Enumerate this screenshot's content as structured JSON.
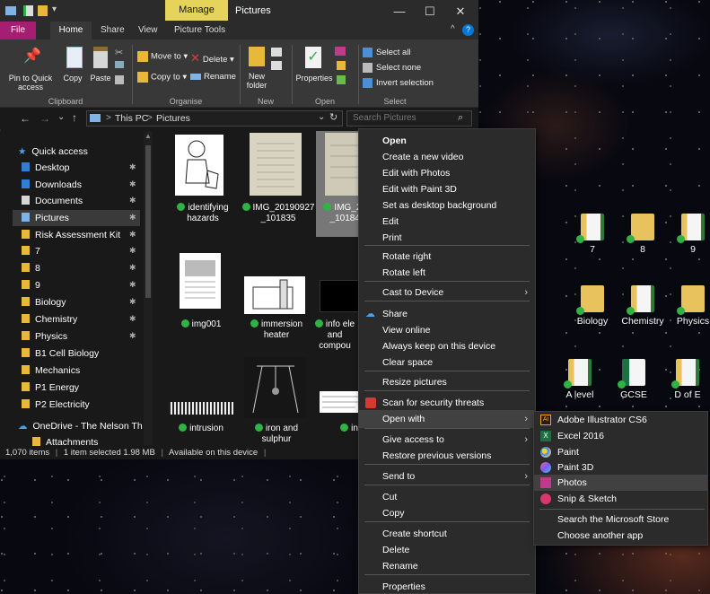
{
  "titlebar": {
    "manage_tab": "Manage",
    "title": "Pictures",
    "minimize": "—",
    "maximize": "☐",
    "close": "✕"
  },
  "tabs": {
    "file": "File",
    "home": "Home",
    "share": "Share",
    "view": "View",
    "picture_tools": "Picture Tools"
  },
  "ribbon": {
    "pin": "Pin to Quick access",
    "copy": "Copy",
    "paste": "Paste",
    "move_to": "Move to",
    "copy_to": "Copy to",
    "delete": "Delete",
    "rename": "Rename",
    "new_folder": "New folder",
    "properties": "Properties",
    "select_all": "Select all",
    "select_none": "Select none",
    "invert_selection": "Invert selection",
    "groups": {
      "clipboard": "Clipboard",
      "organise": "Organise",
      "new": "New",
      "open": "Open",
      "select": "Select"
    }
  },
  "address": {
    "path_this_pc": "This PC",
    "path_pictures": "Pictures",
    "search_placeholder": "Search Pictures",
    "sep": ">"
  },
  "nav": {
    "quick_access": "Quick access",
    "items": [
      {
        "label": "Desktop",
        "pinned": true
      },
      {
        "label": "Downloads",
        "pinned": true
      },
      {
        "label": "Documents",
        "pinned": true
      },
      {
        "label": "Pictures",
        "pinned": true
      },
      {
        "label": "Risk Assessment Kit",
        "pinned": true
      },
      {
        "label": "7",
        "pinned": true
      },
      {
        "label": "8",
        "pinned": true
      },
      {
        "label": "9",
        "pinned": true
      },
      {
        "label": "Biology",
        "pinned": true
      },
      {
        "label": "Chemistry",
        "pinned": true
      },
      {
        "label": "Physics",
        "pinned": true
      },
      {
        "label": "B1 Cell Biology",
        "pinned": false
      },
      {
        "label": "Mechanics",
        "pinned": false
      },
      {
        "label": "P1 Energy",
        "pinned": false
      },
      {
        "label": "P2 Electricity",
        "pinned": false
      }
    ],
    "onedrive": "OneDrive - The Nelson Th",
    "attachments": "Attachments"
  },
  "files": [
    {
      "line1": "identifying",
      "line2": "hazards"
    },
    {
      "line1": "IMG_20190927",
      "line2": "_101835"
    },
    {
      "line1": "IMG_201",
      "line2": "_101842"
    },
    {
      "line1": "img001",
      "line2": ""
    },
    {
      "line1": "immersion",
      "line2": "heater"
    },
    {
      "line1": "info ele",
      "line2": "and",
      "line3": "compou"
    },
    {
      "line1": "intrusion",
      "line2": ""
    },
    {
      "line1": "iron and",
      "line2": "sulphur"
    },
    {
      "line1": "in",
      "line2": ""
    }
  ],
  "status": {
    "items": "1,070 items",
    "selected": "1 item selected",
    "size": "1.98 MB",
    "availability": "Available on this device",
    "sep": "|"
  },
  "context_menu": {
    "open": "Open",
    "create_video": "Create a new video",
    "edit_photos": "Edit with Photos",
    "edit_paint3d": "Edit with Paint 3D",
    "set_bg": "Set as desktop background",
    "edit": "Edit",
    "print": "Print",
    "rotate_right": "Rotate right",
    "rotate_left": "Rotate left",
    "cast": "Cast to Device",
    "share": "Share",
    "view_online": "View online",
    "always_keep": "Always keep on this device",
    "clear_space": "Clear space",
    "resize": "Resize pictures",
    "scan": "Scan for security threats",
    "open_with": "Open with",
    "give_access": "Give access to",
    "restore": "Restore previous versions",
    "send_to": "Send to",
    "cut": "Cut",
    "copy": "Copy",
    "create_shortcut": "Create shortcut",
    "delete": "Delete",
    "rename": "Rename",
    "properties": "Properties"
  },
  "submenu": {
    "illustrator": "Adobe Illustrator CS6",
    "excel": "Excel 2016",
    "paint": "Paint",
    "paint3d": "Paint 3D",
    "photos": "Photos",
    "snip": "Snip & Sketch",
    "store": "Search the Microsoft Store",
    "choose": "Choose another app",
    "illustrator_icon_text": "Ai",
    "excel_icon_text": "X"
  },
  "desktop_icons": [
    {
      "label": "7"
    },
    {
      "label": "8"
    },
    {
      "label": "9"
    },
    {
      "label": "Biology"
    },
    {
      "label": "Chemistry"
    },
    {
      "label": "Physics"
    },
    {
      "label": "A level"
    },
    {
      "label": "GCSE"
    },
    {
      "label": "D of E"
    }
  ],
  "colors": {
    "file_tab": "#a51e71",
    "manage_tab": "#e6d35a",
    "accent": "#0078d7",
    "ok_green": "#2fb344"
  }
}
